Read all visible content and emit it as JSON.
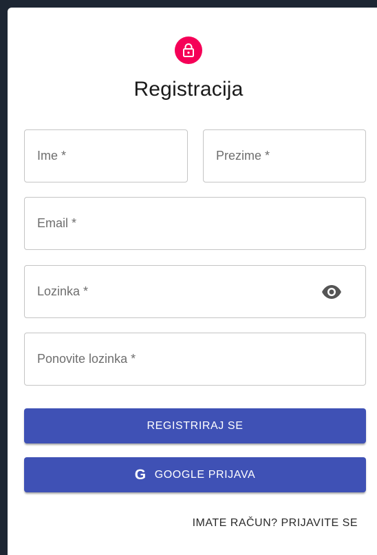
{
  "form": {
    "title": "Registracija",
    "icon": "lock-icon",
    "accent_color": "#f50057",
    "primary_color": "#3f51b5",
    "fields": {
      "first_name": {
        "label": "Ime *"
      },
      "last_name": {
        "label": "Prezime *"
      },
      "email": {
        "label": "Email *"
      },
      "password": {
        "label": "Lozinka *",
        "toggle_icon": "eye-icon"
      },
      "confirm_password": {
        "label": "Ponovite lozinka *"
      }
    },
    "register_button": {
      "label": "REGISTRIRAJ SE"
    },
    "google_button": {
      "icon_text": "G",
      "label": "GOOGLE PRIJAVA"
    },
    "login_link": {
      "label": "IMATE RAČUN? PRIJAVITE SE"
    }
  }
}
